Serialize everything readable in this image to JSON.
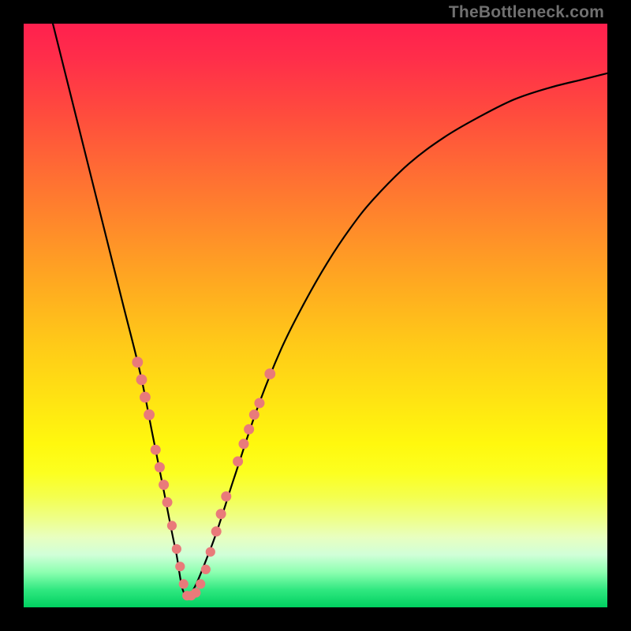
{
  "attribution": "TheBottleneck.com",
  "colors": {
    "frame": "#000000",
    "marker": "#e97a7a",
    "curve": "#000000",
    "gradient_top": "#ff204c",
    "gradient_bottom": "#07c760"
  },
  "chart_data": {
    "type": "line",
    "title": "",
    "xlabel": "",
    "ylabel": "",
    "xlim": [
      0,
      100
    ],
    "ylim": [
      0,
      100
    ],
    "grid": false,
    "legend": false,
    "series": [
      {
        "name": "bottleneck-curve",
        "x": [
          5,
          8,
          11,
          14,
          17,
          20,
          22,
          24,
          26,
          28,
          32,
          36,
          40,
          44,
          48,
          52,
          56,
          60,
          66,
          72,
          78,
          84,
          90,
          96,
          100
        ],
        "y": [
          100,
          88,
          76,
          64,
          52,
          40,
          30,
          20,
          10,
          2,
          10,
          22,
          34,
          44,
          52,
          59,
          65,
          70,
          76,
          80.5,
          84,
          87,
          89,
          90.5,
          91.5
        ]
      }
    ],
    "markers": {
      "name": "highlighted-points",
      "points": [
        {
          "x": 19.5,
          "y": 42,
          "r": 1.7
        },
        {
          "x": 20.2,
          "y": 39,
          "r": 1.7
        },
        {
          "x": 20.8,
          "y": 36,
          "r": 1.7
        },
        {
          "x": 21.5,
          "y": 33,
          "r": 1.7
        },
        {
          "x": 22.6,
          "y": 27,
          "r": 1.6
        },
        {
          "x": 23.3,
          "y": 24,
          "r": 1.6
        },
        {
          "x": 24.0,
          "y": 21,
          "r": 1.6
        },
        {
          "x": 24.6,
          "y": 18,
          "r": 1.6
        },
        {
          "x": 25.4,
          "y": 14,
          "r": 1.5
        },
        {
          "x": 26.2,
          "y": 10,
          "r": 1.5
        },
        {
          "x": 26.8,
          "y": 7,
          "r": 1.5
        },
        {
          "x": 27.4,
          "y": 4,
          "r": 1.5
        },
        {
          "x": 28.0,
          "y": 2,
          "r": 1.5
        },
        {
          "x": 28.7,
          "y": 2,
          "r": 1.5
        },
        {
          "x": 29.5,
          "y": 2.5,
          "r": 1.5
        },
        {
          "x": 30.3,
          "y": 4,
          "r": 1.5
        },
        {
          "x": 31.2,
          "y": 6.5,
          "r": 1.5
        },
        {
          "x": 32.0,
          "y": 9.5,
          "r": 1.5
        },
        {
          "x": 33.0,
          "y": 13,
          "r": 1.6
        },
        {
          "x": 33.8,
          "y": 16,
          "r": 1.6
        },
        {
          "x": 34.7,
          "y": 19,
          "r": 1.6
        },
        {
          "x": 36.7,
          "y": 25,
          "r": 1.6
        },
        {
          "x": 37.7,
          "y": 28,
          "r": 1.6
        },
        {
          "x": 38.6,
          "y": 30.5,
          "r": 1.6
        },
        {
          "x": 39.5,
          "y": 33,
          "r": 1.6
        },
        {
          "x": 40.4,
          "y": 35,
          "r": 1.6
        },
        {
          "x": 42.2,
          "y": 40,
          "r": 1.7
        }
      ]
    }
  }
}
